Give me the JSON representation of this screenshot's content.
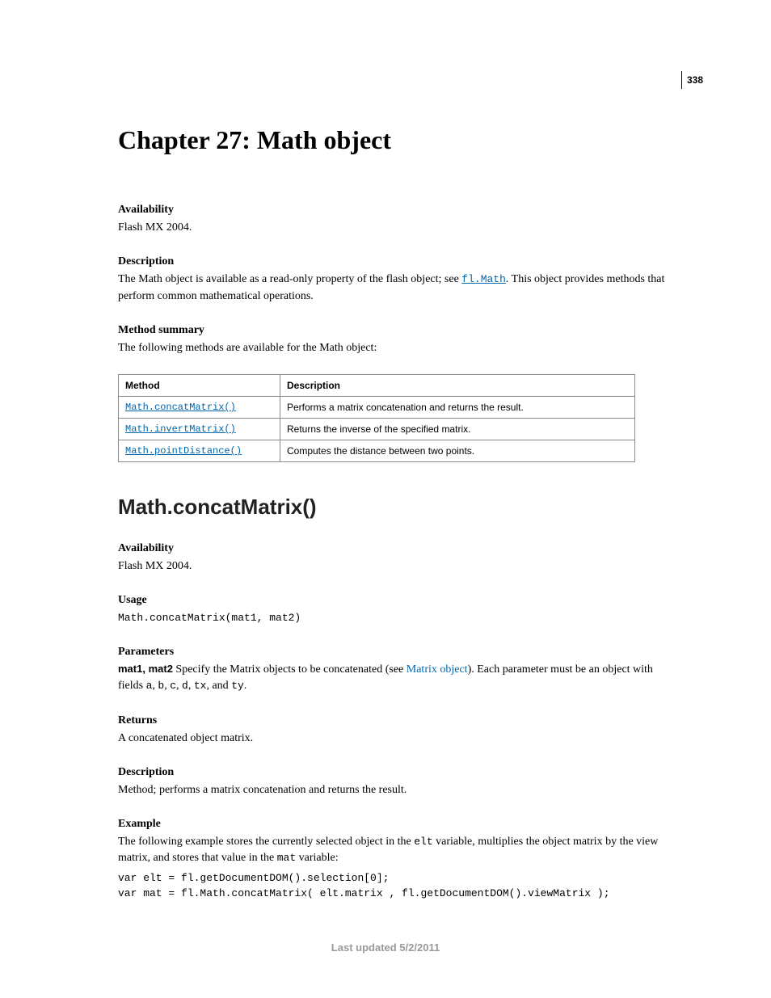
{
  "page_number": "338",
  "chapter_title": "Chapter 27: Math object",
  "intro": {
    "availability_h": "Availability",
    "availability_t": "Flash MX 2004.",
    "description_h": "Description",
    "description_pre": "The Math object is available as a read-only property of the flash object; see ",
    "description_link": "fl.Math",
    "description_post": ". This object provides methods that perform common mathematical operations.",
    "method_summary_h": "Method summary",
    "method_summary_t": "The following methods are available for the Math object:"
  },
  "table": {
    "col_method": "Method",
    "col_desc": "Description",
    "rows": [
      {
        "method": "Math.concatMatrix()",
        "desc": "Performs a matrix concatenation and returns the result."
      },
      {
        "method": "Math.invertMatrix()",
        "desc": "Returns the inverse of the specified matrix."
      },
      {
        "method": "Math.pointDistance()",
        "desc": "Computes the distance between two points."
      }
    ]
  },
  "section_title": "Math.concatMatrix()",
  "sec": {
    "availability_h": "Availability",
    "availability_t": "Flash MX 2004.",
    "usage_h": "Usage",
    "usage_code": "Math.concatMatrix(mat1, mat2)",
    "parameters_h": "Parameters",
    "param_name": "mat1, mat2",
    "param_pre": " Specify the Matrix objects to be concatenated (see ",
    "param_link": "Matrix object",
    "param_post1": "). Each parameter must be an object with fields ",
    "f_a": "a",
    "f_b": "b",
    "f_c": "c",
    "f_d": "d",
    "f_tx": "tx",
    "f_ty": "ty",
    "param_and": ", and ",
    "param_end": ".",
    "returns_h": "Returns",
    "returns_t": "A concatenated object matrix.",
    "description_h": "Description",
    "description_t": "Method; performs a matrix concatenation and returns the result.",
    "example_h": "Example",
    "example_pre": "The following example stores the currently selected object in the ",
    "example_var1": "elt",
    "example_mid": " variable, multiplies the object matrix by the view matrix, and stores that value in the ",
    "example_var2": "mat",
    "example_post": " variable:",
    "example_code": "var elt = fl.getDocumentDOM().selection[0];\nvar mat = fl.Math.concatMatrix( elt.matrix , fl.getDocumentDOM().viewMatrix );"
  },
  "footer": "Last updated 5/2/2011"
}
